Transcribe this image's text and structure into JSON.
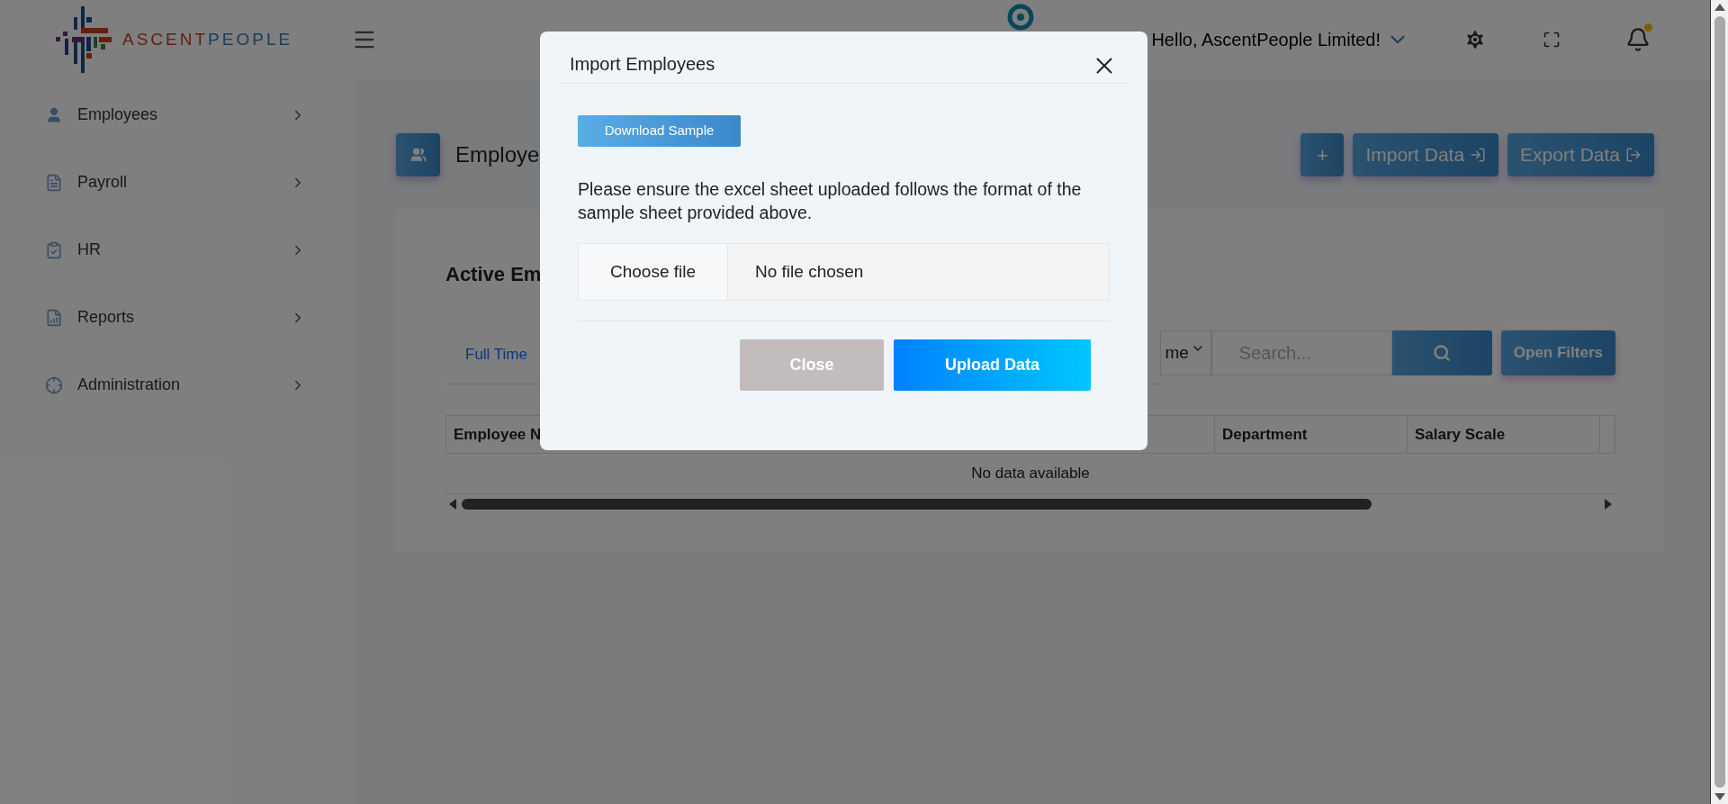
{
  "logo": {
    "first": "ASCENT",
    "second": "PEOPLE"
  },
  "header": {
    "greeting": "Hello, AscentPeople Limited!",
    "notification_dot": true
  },
  "sidebar": {
    "items": [
      {
        "label": "Employees",
        "kind": "person"
      },
      {
        "label": "Payroll",
        "kind": "document"
      },
      {
        "label": "HR",
        "kind": "clipboard"
      },
      {
        "label": "Reports",
        "kind": "report"
      },
      {
        "label": "Administration",
        "kind": "target"
      }
    ]
  },
  "page": {
    "title": "Employe",
    "actions": [
      {
        "kind": "add",
        "label": "+"
      },
      {
        "kind": "import",
        "label": "Import Data"
      },
      {
        "kind": "export",
        "label": "Export Data"
      }
    ]
  },
  "card": {
    "title": "Active Em",
    "tabs": [
      {
        "label": "Full Time",
        "selected": true
      }
    ],
    "select_value": "me",
    "search": {
      "placeholder": "Search..."
    },
    "filters_button": "Open Filters",
    "table": {
      "columns": [
        "Employee N",
        "Department",
        "Salary Scale"
      ],
      "empty_text": "No data available"
    }
  },
  "modal": {
    "title": "Import Employees",
    "download_button": "Download Sample",
    "instructions": "Please ensure the excel sheet uploaded follows the format of the sample sheet provided above.",
    "file_button": "Choose file",
    "file_status": "No file chosen",
    "buttons": [
      {
        "kind": "secondary",
        "label": "Close"
      },
      {
        "kind": "primary",
        "label": "Upload Data"
      }
    ]
  }
}
